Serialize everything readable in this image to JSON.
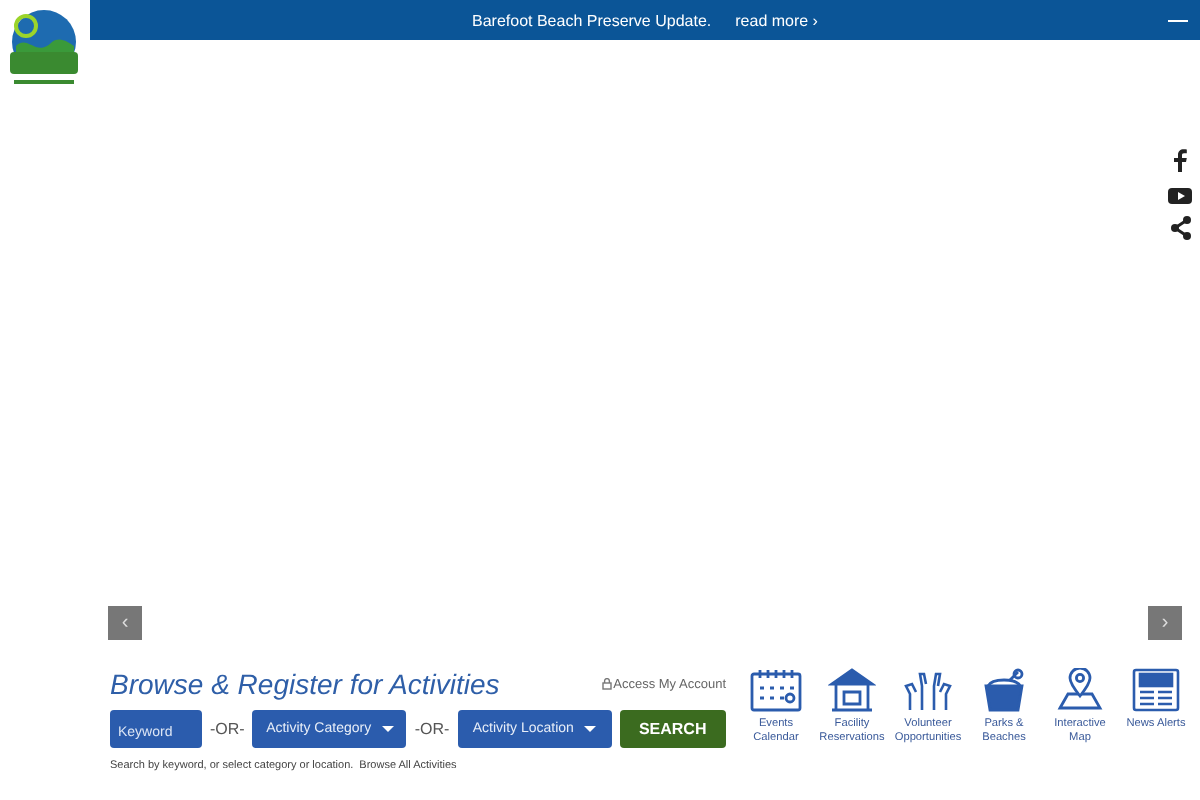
{
  "alert_bar": {
    "message": "Barefoot Beach Preserve Update.",
    "link": "read more ›"
  },
  "carousel": {
    "prev": "‹",
    "next": "›"
  },
  "social": [
    {
      "kind": "facebook"
    },
    {
      "kind": "youtube"
    },
    {
      "kind": "share"
    }
  ],
  "activity_search": {
    "title": "Browse & Register for Activities",
    "account_link": "Access My Account",
    "keyword_placeholder": "Keyword",
    "separators": [
      "-OR-",
      "-OR-"
    ],
    "category_dropdown": "Activity Category",
    "location_dropdown": "Activity Location",
    "search_button": "SEARCH",
    "help_text": "Search by keyword, or select category or location.",
    "browse_link": "Browse All Activities"
  },
  "quick_links": [
    {
      "kind": "calendar",
      "label": "Events Calendar"
    },
    {
      "kind": "gazebo",
      "label": "Facility Reservations"
    },
    {
      "kind": "hands",
      "label": "Volunteer Opportunities"
    },
    {
      "kind": "bucket",
      "label": "Parks & Beaches"
    },
    {
      "kind": "map",
      "label": "Interactive Map"
    },
    {
      "kind": "news",
      "label": "News Alerts"
    }
  ]
}
